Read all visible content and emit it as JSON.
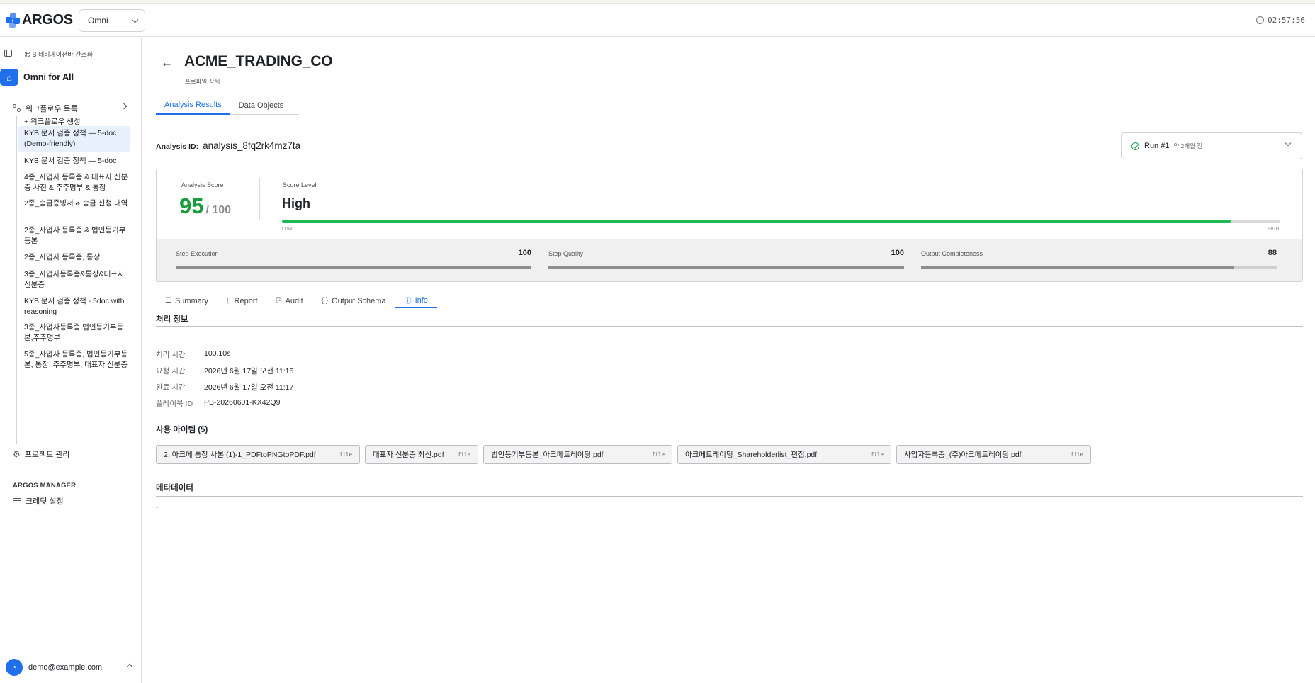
{
  "app": {
    "logo_text": "ARGOS",
    "project_select": "Omni",
    "clock": "02:57:56",
    "colors": {
      "accent": "#1f6feb",
      "success": "#1aa34a",
      "score_green": "#1a9c3c"
    }
  },
  "sidebar": {
    "nav_hint": "⌘ B 네비게이션바 간소화",
    "home_label": "Omni for All",
    "workflows_label": "워크플로우 목록",
    "workflows": [
      {
        "label": "+ 워크플로우 생성"
      },
      {
        "label": "KYB 문서 검증 정책 — 5-doc (Demo-friendly)"
      },
      {
        "label": "KYB 문서 검증 정책 — 5-doc"
      },
      {
        "label": "4종_사업자 등록증 & 대표자 신분증 사진 & 주주명부 & 통장"
      },
      {
        "label": "2종_송금증빙서 & 송금 신청 내역"
      },
      {
        "label": "2종_사업자 등록증 & 법인등기부등본"
      },
      {
        "label": "2종_사업자 등록증, 통장"
      },
      {
        "label": "3종_사업자등록증&통장&대표자신분증"
      },
      {
        "label": "KYB 문서 검증 정책 - 5doc with reasoning"
      },
      {
        "label": "3종_사업자등록증,법인등기부등본,주주명부"
      },
      {
        "label": "5종_사업자 등록증, 법인등기부등본, 통장, 주주명부, 대표자 신분증"
      }
    ],
    "project_mgmt": "프로젝트 관리",
    "manager_heading": "ARGOS MANAGER",
    "credit_settings": "크레딧 설정",
    "user_email": "demo@example.com"
  },
  "header": {
    "title": "ACME_TRADING_CO",
    "subtitle": "프로파일 상세",
    "tabs": [
      {
        "label": "Analysis Results"
      },
      {
        "label": "Data Objects"
      }
    ]
  },
  "analysis": {
    "id_label": "Analysis ID:",
    "id_value": "analysis_8fq2rk4mz7ta",
    "run_label": "Run #1",
    "run_ago": "약 2개월 전"
  },
  "score": {
    "score_label": "Analysis Score",
    "score_value": "95",
    "score_max": "/ 100",
    "level_label": "Score Level",
    "level_value": "High",
    "level_fraction": 0.95,
    "low_label": "LOW",
    "high_label": "HIGH",
    "metrics": [
      {
        "label": "Step Execution",
        "value": "100",
        "fraction": 1.0
      },
      {
        "label": "Step Quality",
        "value": "100",
        "fraction": 1.0
      },
      {
        "label": "Output Completeness",
        "value": "88",
        "fraction": 0.88
      }
    ]
  },
  "subtabs": [
    {
      "label": "Summary",
      "icon": "list-check-icon"
    },
    {
      "label": "Report",
      "icon": "document-icon"
    },
    {
      "label": "Audit",
      "icon": "scroll-icon"
    },
    {
      "label": "Output Schema",
      "icon": "braces-icon"
    },
    {
      "label": "Info",
      "icon": "info-icon"
    }
  ],
  "info": {
    "processing_heading": "처리 정보",
    "rows": [
      {
        "key": "처리 시간",
        "value": "100.10s"
      },
      {
        "key": "요청 시간",
        "value": "2026년 6월 17일 오전 11:15"
      },
      {
        "key": "완료 시간",
        "value": "2026년 6월 17일 오전 11:17"
      },
      {
        "key": "플레이북 ID",
        "value": "PB-20260601-KX42Q9"
      }
    ],
    "items_heading": "사용 아이템 (5)",
    "files": [
      {
        "name": "2. 아크메 통장 사본 (1)-1_PDFtoPNGtoPDF.pdf",
        "tag": "file"
      },
      {
        "name": "대표자 신분증 최신.pdf",
        "tag": "file"
      },
      {
        "name": "법인등기부등본_아크메트레이딩.pdf",
        "tag": "file"
      },
      {
        "name": "아크메트레이딩_Shareholderlist_편집.pdf",
        "tag": "file"
      },
      {
        "name": "사업자등록증_(주)아크메트레이딩.pdf",
        "tag": "file"
      }
    ],
    "metadata_heading": "메타데이터",
    "metadata_value": "-"
  }
}
